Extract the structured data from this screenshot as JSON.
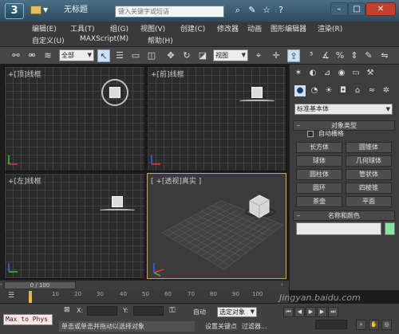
{
  "titlebar": {
    "app_icon": "3ds-max-icon",
    "doc_title": "无标题",
    "search_placeholder": "键入关键字或短语"
  },
  "menu": {
    "row1": [
      "编辑(E)",
      "工具(T)",
      "组(G)",
      "视图(V)",
      "创建(C)",
      "修改器",
      "动画",
      "图形编辑器",
      "渲染(R)"
    ],
    "row2": [
      "自定义(U)",
      "MAXScript(M)",
      "帮助(H)"
    ]
  },
  "toolbar": {
    "filter_dropdown": "全部",
    "ref_coord_dropdown": "视图"
  },
  "viewports": {
    "top": "+[顶]线框",
    "front": "+[前]线框",
    "left": "+[左]线框",
    "perspective": "[ +[透视]真实 ]"
  },
  "command_panel": {
    "category_dropdown": "标准基本体",
    "object_type_header": "对象类型",
    "autogrid_label": "自动栅格",
    "object_buttons": [
      "长方体",
      "圆锥体",
      "球体",
      "几何球体",
      "圆柱体",
      "管状体",
      "圆环",
      "四棱锥",
      "茶壶",
      "平面"
    ],
    "name_color_header": "名称和颜色",
    "swatch_color": "#87e3a6"
  },
  "timeline": {
    "slider_text": "0 / 100",
    "ticks": [
      "0",
      "10",
      "20",
      "30",
      "40",
      "50",
      "60",
      "70",
      "80",
      "90",
      "100"
    ]
  },
  "statusbar": {
    "maxscript_text": "Max to Phys",
    "prompt_text": "单击或单击并拖动以选择对象",
    "x_label": "X:",
    "y_label": "Y:",
    "auto_key_label": "自动",
    "selection_dropdown": "选定对象",
    "set_key_label": "设置关键点",
    "filters_label": "过滤器..."
  },
  "watermark": "Jingyan.baidu.com"
}
